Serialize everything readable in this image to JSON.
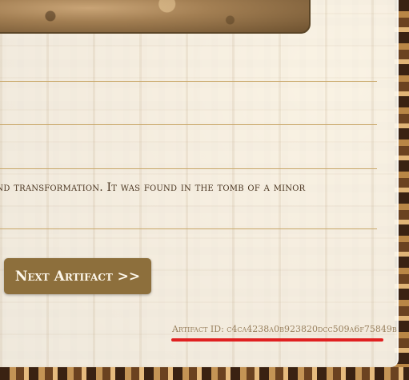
{
  "artifact": {
    "description": "rth and transformation. It was found in the tomb of a minor",
    "next_button_label": "Next Artifact >>",
    "id_label": "Artifact ID:",
    "id_value": "c4ca4238a0b923820dcc509a6f75849b"
  },
  "colors": {
    "button_bg": "#8d6f3c",
    "highlight_underline": "#e02020",
    "rule": "#c9a86a"
  }
}
